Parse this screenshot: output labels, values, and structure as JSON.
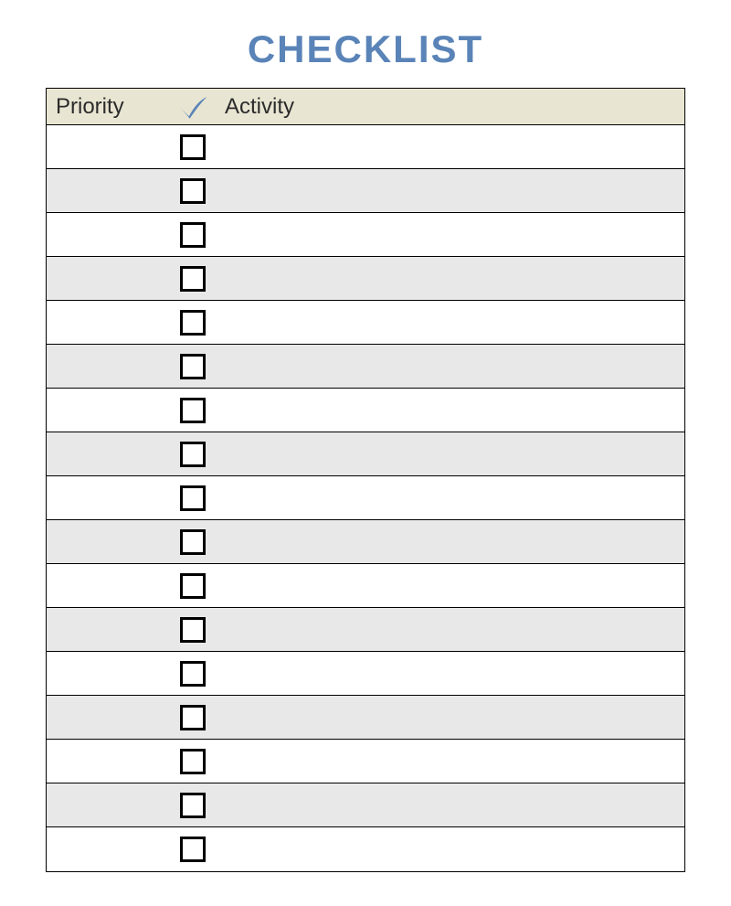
{
  "title": "CHECKLIST",
  "columns": {
    "priority": "Priority",
    "activity": "Activity"
  },
  "rows": [
    {
      "priority": "",
      "checked": false,
      "activity": ""
    },
    {
      "priority": "",
      "checked": false,
      "activity": ""
    },
    {
      "priority": "",
      "checked": false,
      "activity": ""
    },
    {
      "priority": "",
      "checked": false,
      "activity": ""
    },
    {
      "priority": "",
      "checked": false,
      "activity": ""
    },
    {
      "priority": "",
      "checked": false,
      "activity": ""
    },
    {
      "priority": "",
      "checked": false,
      "activity": ""
    },
    {
      "priority": "",
      "checked": false,
      "activity": ""
    },
    {
      "priority": "",
      "checked": false,
      "activity": ""
    },
    {
      "priority": "",
      "checked": false,
      "activity": ""
    },
    {
      "priority": "",
      "checked": false,
      "activity": ""
    },
    {
      "priority": "",
      "checked": false,
      "activity": ""
    },
    {
      "priority": "",
      "checked": false,
      "activity": ""
    },
    {
      "priority": "",
      "checked": false,
      "activity": ""
    },
    {
      "priority": "",
      "checked": false,
      "activity": ""
    },
    {
      "priority": "",
      "checked": false,
      "activity": ""
    },
    {
      "priority": "",
      "checked": false,
      "activity": ""
    }
  ]
}
